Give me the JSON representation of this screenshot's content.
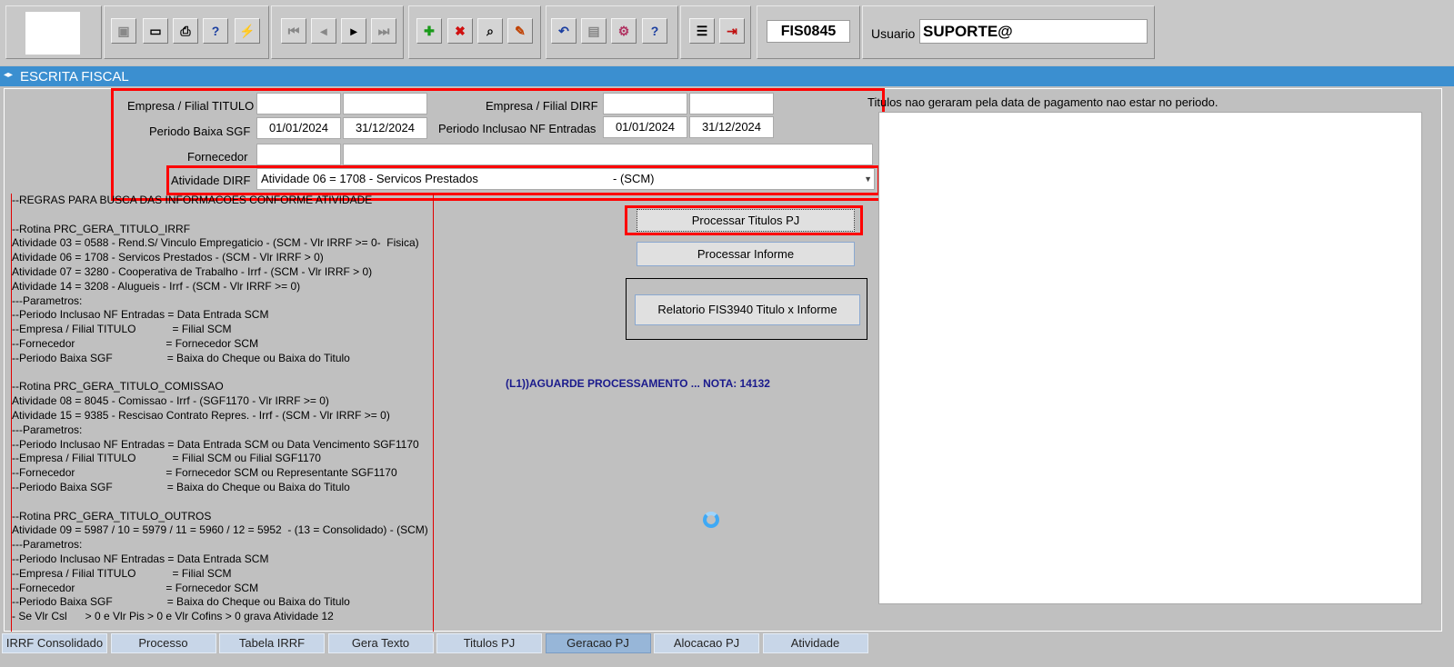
{
  "toolbar": {
    "form_code": "FIS0845",
    "user_label": "Usuario",
    "user_value": "SUPORTE@",
    "icons": [
      "save-icon",
      "window-icon",
      "print-icon",
      "query-help-icon",
      "execute-icon",
      "first-record-icon",
      "prev-record-icon",
      "next-record-icon",
      "last-record-icon",
      "insert-record-icon",
      "delete-record-icon",
      "find-icon",
      "edit-icon",
      "undo-icon",
      "clipboard-icon",
      "settings-icon",
      "help-icon",
      "menu-icon",
      "exit-icon"
    ]
  },
  "title": "ESCRITA FISCAL",
  "form": {
    "empresa_titulo_label": "Empresa / Filial TITULO",
    "empresa_dirf_label": "Empresa / Filial  DIRF",
    "periodo_baixa_label": "Periodo Baixa SGF",
    "periodo_baixa_from": "01/01/2024",
    "periodo_baixa_to": "31/12/2024",
    "periodo_inclusao_label": "Periodo Inclusao NF Entradas",
    "periodo_inclusao_from": "01/01/2024",
    "periodo_inclusao_to": "31/12/2024",
    "fornecedor_label": "Fornecedor",
    "atividade_label": "Atividade DIRF",
    "atividade_value": "Atividade 06 = 1708 - Servicos Prestados",
    "atividade_suffix": "- (SCM)"
  },
  "rules": [
    "--REGRAS PARA BUSCA DAS INFORMACOES CONFORME ATIVIDADE",
    "",
    "--Rotina PRC_GERA_TITULO_IRRF",
    "Atividade 03 = 0588 - Rend.S/ Vinculo Empregaticio - (SCM - Vlr IRRF >= 0-  Fisica)",
    "Atividade 06 = 1708 - Servicos Prestados - (SCM - Vlr IRRF > 0)",
    "Atividade 07 = 3280 - Cooperativa de Trabalho - Irrf - (SCM - Vlr IRRF > 0)",
    "Atividade 14 = 3208 - Alugueis - Irrf - (SCM - Vlr IRRF >= 0)",
    "---Parametros:",
    "--Periodo Inclusao NF Entradas = Data Entrada SCM",
    "--Empresa / Filial TITULO            = Filial SCM",
    "--Fornecedor                              = Fornecedor SCM",
    "--Periodo Baixa SGF                  = Baixa do Cheque ou Baixa do Titulo",
    "",
    "--Rotina PRC_GERA_TITULO_COMISSAO",
    "Atividade 08 = 8045 - Comissao - Irrf - (SGF1170 - Vlr IRRF >= 0)",
    "Atividade 15 = 9385 - Rescisao Contrato Repres. - Irrf - (SCM - Vlr IRRF >= 0)",
    "---Parametros:",
    "--Periodo Inclusao NF Entradas = Data Entrada SCM ou Data Vencimento SGF1170",
    "--Empresa / Filial TITULO            = Filial SCM ou Filial SGF1170",
    "--Fornecedor                              = Fornecedor SCM ou Representante SGF1170",
    "--Periodo Baixa SGF                  = Baixa do Cheque ou Baixa do Titulo",
    "",
    "--Rotina PRC_GERA_TITULO_OUTROS",
    "Atividade 09 = 5987 / 10 = 5979 / 11 = 5960 / 12 = 5952  - (13 = Consolidado) - (SCM)",
    "---Parametros:",
    "--Periodo Inclusao NF Entradas = Data Entrada SCM",
    "--Empresa / Filial TITULO            = Filial SCM",
    "--Fornecedor                              = Fornecedor SCM",
    "--Periodo Baixa SGF                  = Baixa do Cheque ou Baixa do Titulo",
    "- Se Vlr Csl      > 0 e Vlr Pis > 0 e Vlr Cofins > 0 grava Atividade 12"
  ],
  "buttons": {
    "processar_titulos": "Processar Titulos PJ",
    "processar_informe": "Processar Informe",
    "relatorio": "Relatorio FIS3940 Titulo x Informe"
  },
  "status_message": "(L1))AGUARDE PROCESSAMENTO ... NOTA: 14132",
  "info_label": "Titulos nao geraram pela data de pagamento nao estar no periodo.",
  "tabs": [
    "IRRF Consolidado",
    "Processo",
    "Tabela IRRF",
    "Gera Texto",
    "Titulos PJ",
    "Geracao PJ",
    "Alocacao PJ",
    "Atividade"
  ],
  "active_tab": "Geracao PJ",
  "colors": {
    "title_bar": "#3b8fd0",
    "highlight": "#ff0000",
    "status_text": "#1a1a8c"
  }
}
